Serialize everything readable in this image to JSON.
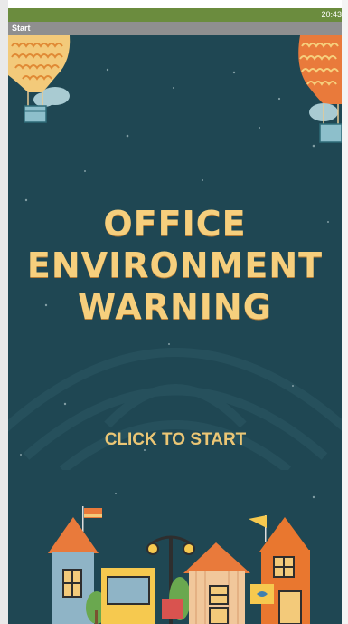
{
  "status_bar": {
    "time": "20:43"
  },
  "title_bar": {
    "title": "Start"
  },
  "main": {
    "headline": [
      "OFFICE",
      "ENVIRONMENT",
      "WARNING"
    ],
    "start_label": "CLICK TO START"
  },
  "colors": {
    "background": "#1f4753",
    "headline": "#f6cf7d",
    "start_text": "#ebc675",
    "status_bar": "#6b8c3e",
    "title_bar": "#8f8f8f"
  }
}
